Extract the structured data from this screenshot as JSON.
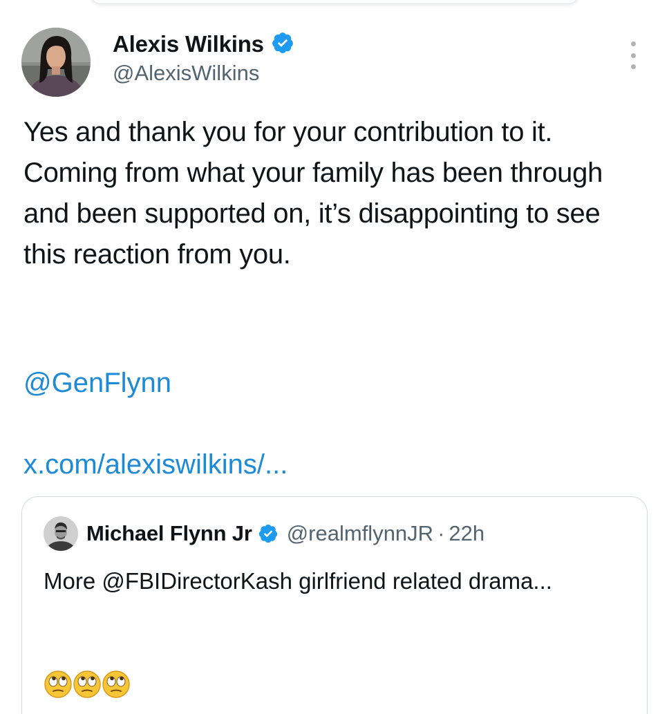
{
  "author": {
    "display_name": "Alexis Wilkins",
    "handle": "@AlexisWilkins",
    "verified": true,
    "avatar_icon": "profile-photo-avatar"
  },
  "tweet": {
    "text": "Yes and thank you for your contribution to it. Coming from what your family has been through and been supported on, it’s disappointing to see this reaction from you.",
    "mention": "@GenFlynn",
    "link": "x.com/alexiswilkins/..."
  },
  "quoted_tweet": {
    "display_name": "Michael Flynn Jr",
    "handle": "@realmflynnJR",
    "separator": "·",
    "time": "22h",
    "verified": true,
    "text": "More @FBIDirectorKash girlfriend related drama...",
    "emoji": [
      "eye-roll-emoji",
      "eye-roll-emoji",
      "eye-roll-emoji"
    ]
  },
  "colors": {
    "link": "#1c8ad6",
    "verified_badge": "#1d9bf0",
    "secondary_text": "#536471",
    "border": "#cfd9de"
  }
}
